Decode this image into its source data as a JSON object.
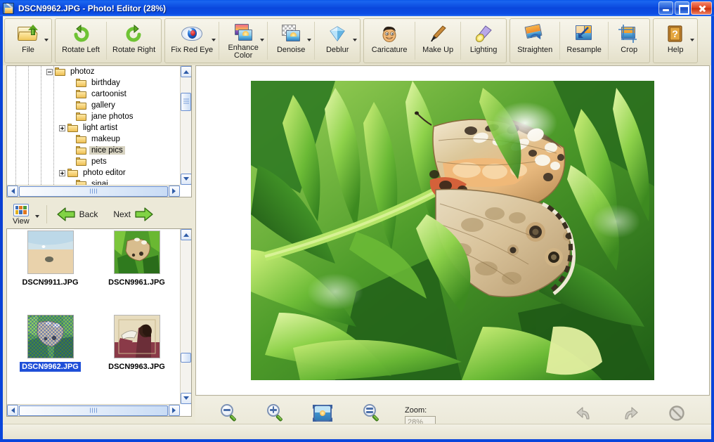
{
  "window": {
    "title": "DSCN9962.JPG - Photo! Editor (28%)",
    "icon": "photo-wand-icon",
    "minimize_label": "",
    "maximize_label": "",
    "close_label": ""
  },
  "toolbar": {
    "groups": [
      {
        "buttons": [
          {
            "label": "File",
            "icon": "open-folder-icon",
            "dropdown": true
          }
        ]
      },
      {
        "buttons": [
          {
            "label": "Rotate Left",
            "icon": "rotate-left-icon",
            "dropdown": false
          },
          {
            "label": "Rotate Right",
            "icon": "rotate-right-icon",
            "dropdown": false
          }
        ]
      },
      {
        "buttons": [
          {
            "label": "Fix Red Eye",
            "icon": "eye-icon",
            "dropdown": true
          },
          {
            "label": "Enhance\nColor",
            "icon": "enhance-color-icon",
            "dropdown": true
          },
          {
            "label": "Denoise",
            "icon": "denoise-icon",
            "dropdown": true
          },
          {
            "label": "Deblur",
            "icon": "deblur-icon",
            "dropdown": true
          }
        ]
      },
      {
        "buttons": [
          {
            "label": "Caricature",
            "icon": "caricature-face-icon",
            "dropdown": false
          },
          {
            "label": "Make Up",
            "icon": "makeup-brush-icon",
            "dropdown": false
          },
          {
            "label": "Lighting",
            "icon": "lighting-lamp-icon",
            "dropdown": false
          }
        ]
      },
      {
        "buttons": [
          {
            "label": "Straighten",
            "icon": "straighten-icon",
            "dropdown": false
          },
          {
            "label": "Resample",
            "icon": "resample-icon",
            "dropdown": false
          },
          {
            "label": "Crop",
            "icon": "crop-icon",
            "dropdown": false
          }
        ]
      },
      {
        "buttons": [
          {
            "label": "Help",
            "icon": "help-book-icon",
            "dropdown": true
          }
        ]
      }
    ]
  },
  "tree": {
    "items": [
      {
        "label": "photoz",
        "depth": 0,
        "expander": "minus",
        "selected": false
      },
      {
        "label": "birthday",
        "depth": 1,
        "expander": "none",
        "selected": false
      },
      {
        "label": "cartoonist",
        "depth": 1,
        "expander": "none",
        "selected": false
      },
      {
        "label": "gallery",
        "depth": 1,
        "expander": "none",
        "selected": false
      },
      {
        "label": "jane photos",
        "depth": 1,
        "expander": "none",
        "selected": false
      },
      {
        "label": "light artist",
        "depth": 1,
        "expander": "plus",
        "selected": false
      },
      {
        "label": "makeup",
        "depth": 1,
        "expander": "none",
        "selected": false
      },
      {
        "label": "nice pics",
        "depth": 1,
        "expander": "none",
        "selected": true
      },
      {
        "label": "pets",
        "depth": 1,
        "expander": "none",
        "selected": false
      },
      {
        "label": "photo editor",
        "depth": 1,
        "expander": "plus",
        "selected": false
      },
      {
        "label": "sinai",
        "depth": 1,
        "expander": "none",
        "selected": false
      }
    ]
  },
  "viewbar": {
    "view_label": "View",
    "view_icon": "grid-view-icon",
    "back_label": "Back",
    "back_icon": "arrow-left-icon",
    "next_label": "Next",
    "next_icon": "arrow-right-icon"
  },
  "thumbnails": {
    "items": [
      {
        "name": "DSCN9911.JPG",
        "selected": false,
        "kind": "beach"
      },
      {
        "name": "DSCN9961.JPG",
        "selected": false,
        "kind": "butterfly"
      },
      {
        "name": "DSCN9962.JPG",
        "selected": true,
        "kind": "butterfly2"
      },
      {
        "name": "DSCN9963.JPG",
        "selected": false,
        "kind": "mural"
      }
    ]
  },
  "canvas": {
    "image_alt": "Painted Lady butterfly resting on green foliage",
    "zoom_percent": "28%"
  },
  "bottombar": {
    "zoom_out_label": "Zoom Out",
    "zoom_out_icon": "magnifier-minus-icon",
    "zoom_in_label": "Zoom In",
    "zoom_in_icon": "magnifier-plus-icon",
    "fit_label": "Fit",
    "fit_icon": "fit-to-window-icon",
    "actual_size_label": "Actual Size",
    "actual_size_icon": "magnifier-equals-icon",
    "zoom_field_label": "Zoom:",
    "zoom_value": "28%",
    "zoom_placeholder": "28%",
    "undo_label": "Undo",
    "undo_icon": "undo-arrow-icon",
    "redo_label": "Redo",
    "redo_icon": "redo-arrow-icon",
    "cancel_label": "Cancel",
    "cancel_icon": "cancel-circle-icon"
  },
  "colors": {
    "titlebar_blue": "#0a47dd",
    "panel_beige": "#ece9d8",
    "selection_blue": "#1f4fd8",
    "accent_green": "#5ea820"
  }
}
